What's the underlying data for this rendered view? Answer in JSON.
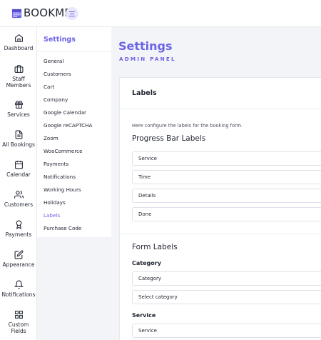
{
  "app": {
    "name": "BOOKME"
  },
  "rail": [
    {
      "id": "dashboard",
      "label": "Dashboard",
      "icon": "home-icon"
    },
    {
      "id": "staff-members",
      "label": "Staff Members",
      "icon": "briefcase-icon"
    },
    {
      "id": "services",
      "label": "Services",
      "icon": "gift-icon"
    },
    {
      "id": "all-bookings",
      "label": "All Bookings",
      "icon": "document-icon"
    },
    {
      "id": "calendar",
      "label": "Calendar",
      "icon": "calendar-icon"
    },
    {
      "id": "customers",
      "label": "Customers",
      "icon": "users-icon"
    },
    {
      "id": "payments",
      "label": "Payments",
      "icon": "award-icon"
    },
    {
      "id": "appearance",
      "label": "Appearance",
      "icon": "edit-icon"
    },
    {
      "id": "notifications",
      "label": "Notifications",
      "icon": "bell-icon"
    },
    {
      "id": "custom-fields",
      "label": "Custom Fields",
      "icon": "grid-icon"
    }
  ],
  "settings_nav": {
    "title": "Settings",
    "items": [
      "General",
      "Customers",
      "Cart",
      "Company",
      "Google Calendar",
      "Google reCAPTCHA",
      "Zoom",
      "WooCommerce",
      "Payments",
      "Notifications",
      "Working Hours",
      "Holidays",
      "Labels",
      "Purchase Code"
    ],
    "active": "Labels"
  },
  "page": {
    "title": "Settings",
    "subtitle": "ADMIN PANEL"
  },
  "labels_card": {
    "title": "Labels",
    "help": "Here configure the labels for the booking form.",
    "progress_section": "Progress Bar Labels",
    "progress_fields": [
      "Service",
      "Time",
      "Details",
      "Done"
    ],
    "form_section": "Form Labels",
    "category_label": "Category",
    "category_fields": [
      "Category",
      "Select category"
    ],
    "service_label": "Service",
    "service_fields": [
      "Service"
    ]
  },
  "colors": {
    "accent": "#6c63e6",
    "background": "#f3f4f8",
    "surface": "#ffffff",
    "border": "#dfe2ea"
  }
}
